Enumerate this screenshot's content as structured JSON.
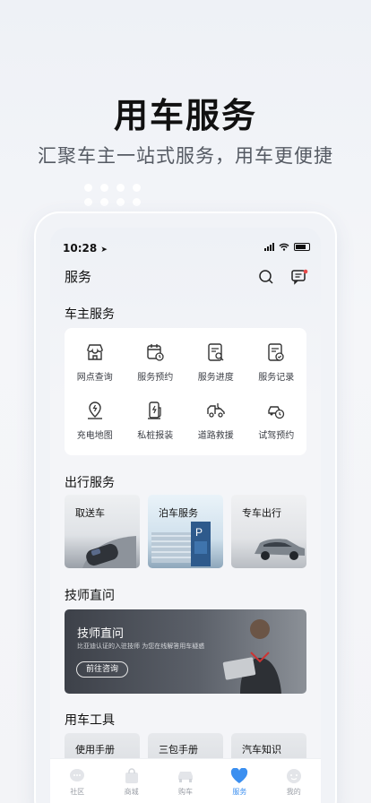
{
  "hero": {
    "title": "用车服务",
    "subtitle": "汇聚车主一站式服务，用车更便捷"
  },
  "status_bar": {
    "time": "10:28"
  },
  "header": {
    "title": "服务",
    "icons": [
      "search-icon",
      "message-icon"
    ]
  },
  "owner_services": {
    "title": "车主服务",
    "items": [
      {
        "label": "网点查询",
        "icon": "store-icon"
      },
      {
        "label": "服务预约",
        "icon": "calendar-clock-icon"
      },
      {
        "label": "服务进度",
        "icon": "document-search-icon"
      },
      {
        "label": "服务记录",
        "icon": "document-check-icon"
      },
      {
        "label": "充电地图",
        "icon": "map-pin-icon"
      },
      {
        "label": "私桩报装",
        "icon": "charger-icon"
      },
      {
        "label": "道路救援",
        "icon": "tow-truck-icon"
      },
      {
        "label": "试驾预约",
        "icon": "car-clock-icon"
      }
    ]
  },
  "travel_services": {
    "title": "出行服务",
    "items": [
      {
        "label": "取送车"
      },
      {
        "label": "泊车服务"
      },
      {
        "label": "专车出行"
      }
    ]
  },
  "technician": {
    "section_title": "技师直问",
    "title": "技师直问",
    "desc": "比亚迪认证的入驻技师 为您在线解答用车疑惑",
    "button": "前往咨询"
  },
  "tools": {
    "title": "用车工具",
    "items": [
      {
        "label": "使用手册"
      },
      {
        "label": "三包手册"
      },
      {
        "label": "汽车知识"
      }
    ]
  },
  "tabbar": {
    "items": [
      {
        "label": "社区",
        "icon": "chat-bubble-icon"
      },
      {
        "label": "商城",
        "icon": "shopping-bag-icon"
      },
      {
        "label": "购车",
        "icon": "car-icon"
      },
      {
        "label": "服务",
        "icon": "heart-icon",
        "active": true
      },
      {
        "label": "我的",
        "icon": "smile-icon"
      }
    ]
  },
  "colors": {
    "accent": "#3b8ff0",
    "badge": "#e84a4a"
  }
}
